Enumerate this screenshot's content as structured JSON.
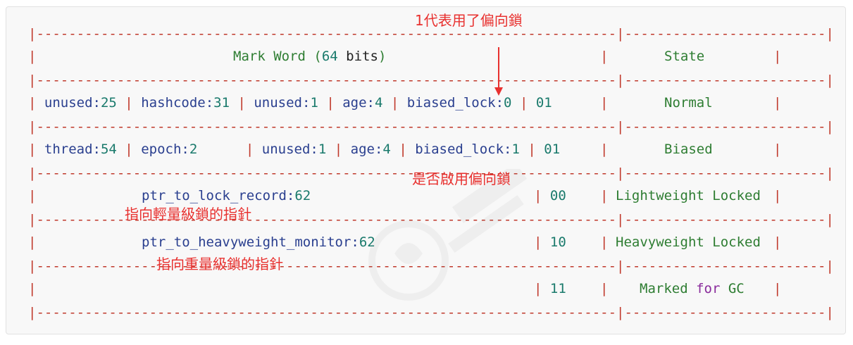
{
  "header": {
    "title_prefix": "Mark Word (",
    "title_bits_num": "64",
    "title_bits_word": " bits",
    "title_suffix": ")",
    "state": "State"
  },
  "rows": {
    "normal": {
      "f1": "unused:",
      "v1": "25",
      "f2": "hashcode:",
      "v2": "31",
      "f3": "unused:",
      "v3": "1",
      "f4": "age:",
      "v4": "4",
      "f5": "biased_lock:",
      "v5": "0",
      "bits": "01",
      "state": "Normal"
    },
    "biased": {
      "f1": "thread:",
      "v1": "54",
      "f2": "epoch:",
      "v2": "2",
      "f3": "unused:",
      "v3": "1",
      "f4": "age:",
      "v4": "4",
      "f5": "biased_lock:",
      "v5": "1",
      "bits": "01",
      "state": "Biased"
    },
    "lightweight": {
      "field": "ptr_to_lock_record:",
      "val": "62",
      "bits": "00",
      "state": "Lightweight Locked"
    },
    "heavyweight": {
      "field": "ptr_to_heavyweight_monitor:",
      "val": "62",
      "bits": "10",
      "state": "Heavyweight Locked"
    },
    "gc": {
      "bits": "11",
      "state_a": "Marked ",
      "state_b": "for",
      "state_c": " GC"
    }
  },
  "annotations": {
    "biased_flag": "1代表用了偏向鎖",
    "enable_biased": "是否啟用偏向鎖",
    "ptr_lightweight": "指向輕量級鎖的指針",
    "ptr_heavyweight": "指向重量級鎖的指針"
  },
  "colors": {
    "border": "#c0392b",
    "annotation": "#e8312f",
    "field": "#2a3f8f",
    "number": "#1a7a6c",
    "state": "#2e7d32",
    "keyword": "#8a2b9c"
  }
}
